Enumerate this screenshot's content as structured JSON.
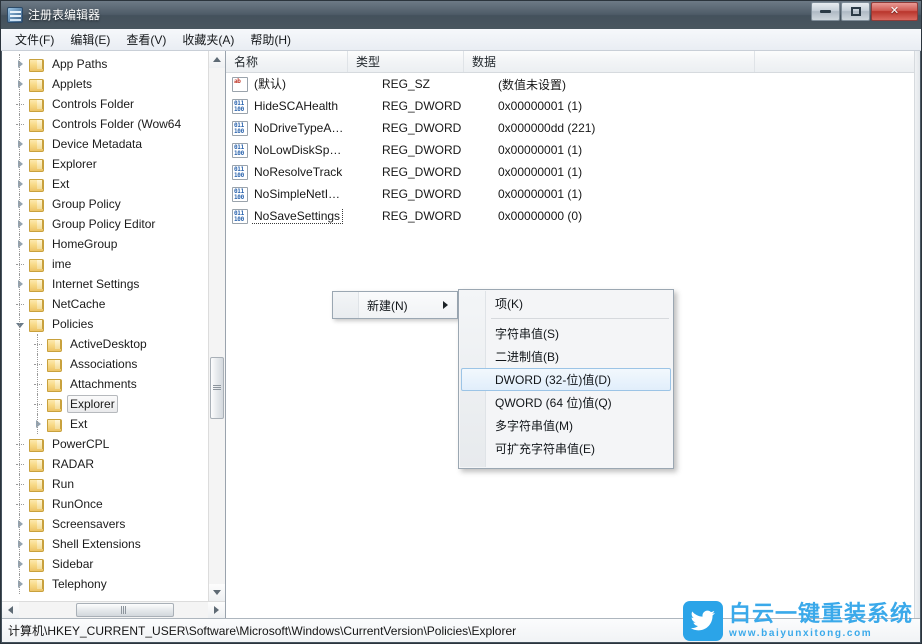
{
  "window": {
    "title": "注册表编辑器",
    "app_icon": "registry-editor-icon",
    "controls": {
      "minimize": "minimize-button",
      "maximize": "maximize-button",
      "close_glyph": "✕"
    }
  },
  "menubar": {
    "items": [
      {
        "label": "文件(F)",
        "name": "menu-file"
      },
      {
        "label": "编辑(E)",
        "name": "menu-edit"
      },
      {
        "label": "查看(V)",
        "name": "menu-view"
      },
      {
        "label": "收藏夹(A)",
        "name": "menu-favorites"
      },
      {
        "label": "帮助(H)",
        "name": "menu-help"
      }
    ]
  },
  "tree": {
    "nodes": [
      {
        "label": "App Paths",
        "indent": 1,
        "state": "collapsed",
        "selected": false
      },
      {
        "label": "Applets",
        "indent": 1,
        "state": "collapsed",
        "selected": false
      },
      {
        "label": "Controls Folder",
        "indent": 1,
        "state": "leaf",
        "selected": false
      },
      {
        "label": "Controls Folder (Wow64",
        "indent": 1,
        "state": "leaf",
        "selected": false
      },
      {
        "label": "Device Metadata",
        "indent": 1,
        "state": "collapsed",
        "selected": false
      },
      {
        "label": "Explorer",
        "indent": 1,
        "state": "collapsed",
        "selected": false
      },
      {
        "label": "Ext",
        "indent": 1,
        "state": "collapsed",
        "selected": false
      },
      {
        "label": "Group Policy",
        "indent": 1,
        "state": "collapsed",
        "selected": false
      },
      {
        "label": "Group Policy Editor",
        "indent": 1,
        "state": "collapsed",
        "selected": false
      },
      {
        "label": "HomeGroup",
        "indent": 1,
        "state": "collapsed",
        "selected": false
      },
      {
        "label": "ime",
        "indent": 1,
        "state": "leaf",
        "selected": false
      },
      {
        "label": "Internet Settings",
        "indent": 1,
        "state": "collapsed",
        "selected": false
      },
      {
        "label": "NetCache",
        "indent": 1,
        "state": "leaf",
        "selected": false
      },
      {
        "label": "Policies",
        "indent": 1,
        "state": "expanded",
        "selected": false
      },
      {
        "label": "ActiveDesktop",
        "indent": 2,
        "state": "leaf",
        "selected": false
      },
      {
        "label": "Associations",
        "indent": 2,
        "state": "leaf",
        "selected": false
      },
      {
        "label": "Attachments",
        "indent": 2,
        "state": "leaf",
        "selected": false
      },
      {
        "label": "Explorer",
        "indent": 2,
        "state": "leaf",
        "selected": true
      },
      {
        "label": "Ext",
        "indent": 2,
        "state": "collapsed",
        "selected": false
      },
      {
        "label": "PowerCPL",
        "indent": 1,
        "state": "leaf",
        "selected": false
      },
      {
        "label": "RADAR",
        "indent": 1,
        "state": "leaf",
        "selected": false
      },
      {
        "label": "Run",
        "indent": 1,
        "state": "leaf",
        "selected": false
      },
      {
        "label": "RunOnce",
        "indent": 1,
        "state": "leaf",
        "selected": false
      },
      {
        "label": "Screensavers",
        "indent": 1,
        "state": "collapsed",
        "selected": false
      },
      {
        "label": "Shell Extensions",
        "indent": 1,
        "state": "collapsed",
        "selected": false
      },
      {
        "label": "Sidebar",
        "indent": 1,
        "state": "collapsed",
        "selected": false
      },
      {
        "label": "Telephony",
        "indent": 1,
        "state": "collapsed",
        "selected": false
      }
    ]
  },
  "list": {
    "columns": [
      {
        "label": "名称",
        "name": "column-name"
      },
      {
        "label": "类型",
        "name": "column-type"
      },
      {
        "label": "数据",
        "name": "column-data"
      }
    ],
    "rows": [
      {
        "name": "(默认)",
        "type": "REG_SZ",
        "data": "(数值未设置)",
        "icon": "string-value-icon",
        "focused": false
      },
      {
        "name": "HideSCAHealth",
        "type": "REG_DWORD",
        "data": "0x00000001 (1)",
        "icon": "dword-value-icon",
        "focused": false
      },
      {
        "name": "NoDriveTypeA…",
        "type": "REG_DWORD",
        "data": "0x000000dd (221)",
        "icon": "dword-value-icon",
        "focused": false
      },
      {
        "name": "NoLowDiskSp…",
        "type": "REG_DWORD",
        "data": "0x00000001 (1)",
        "icon": "dword-value-icon",
        "focused": false
      },
      {
        "name": "NoResolveTrack",
        "type": "REG_DWORD",
        "data": "0x00000001 (1)",
        "icon": "dword-value-icon",
        "focused": false
      },
      {
        "name": "NoSimpleNetI…",
        "type": "REG_DWORD",
        "data": "0x00000001 (1)",
        "icon": "dword-value-icon",
        "focused": false
      },
      {
        "name": "NoSaveSettings",
        "type": "REG_DWORD",
        "data": "0x00000000 (0)",
        "icon": "dword-value-icon",
        "focused": true
      }
    ]
  },
  "context_menu": {
    "parent": {
      "label": "新建(N)",
      "has_submenu": true
    },
    "submenu": [
      {
        "label": "项(K)",
        "highlighted": false,
        "separator_after": true
      },
      {
        "label": "字符串值(S)",
        "highlighted": false,
        "separator_after": false
      },
      {
        "label": "二进制值(B)",
        "highlighted": false,
        "separator_after": false
      },
      {
        "label": "DWORD (32-位)值(D)",
        "highlighted": true,
        "separator_after": false
      },
      {
        "label": "QWORD (64 位)值(Q)",
        "highlighted": false,
        "separator_after": false
      },
      {
        "label": "多字符串值(M)",
        "highlighted": false,
        "separator_after": false
      },
      {
        "label": "可扩充字符串值(E)",
        "highlighted": false,
        "separator_after": false
      }
    ]
  },
  "statusbar": {
    "path": "计算机\\HKEY_CURRENT_USER\\Software\\Microsoft\\Windows\\CurrentVersion\\Policies\\Explorer"
  },
  "watermark": {
    "title": "白云一键重装系统",
    "url": "www.baiyunxitong.com",
    "icon": "bird-logo-icon",
    "color": "#3aa9ea"
  },
  "colors": {
    "titlebar": "#44515c",
    "highlight": "#e1eefb",
    "highlight_border": "#9cc4e6",
    "folder": "#f3d27e"
  }
}
